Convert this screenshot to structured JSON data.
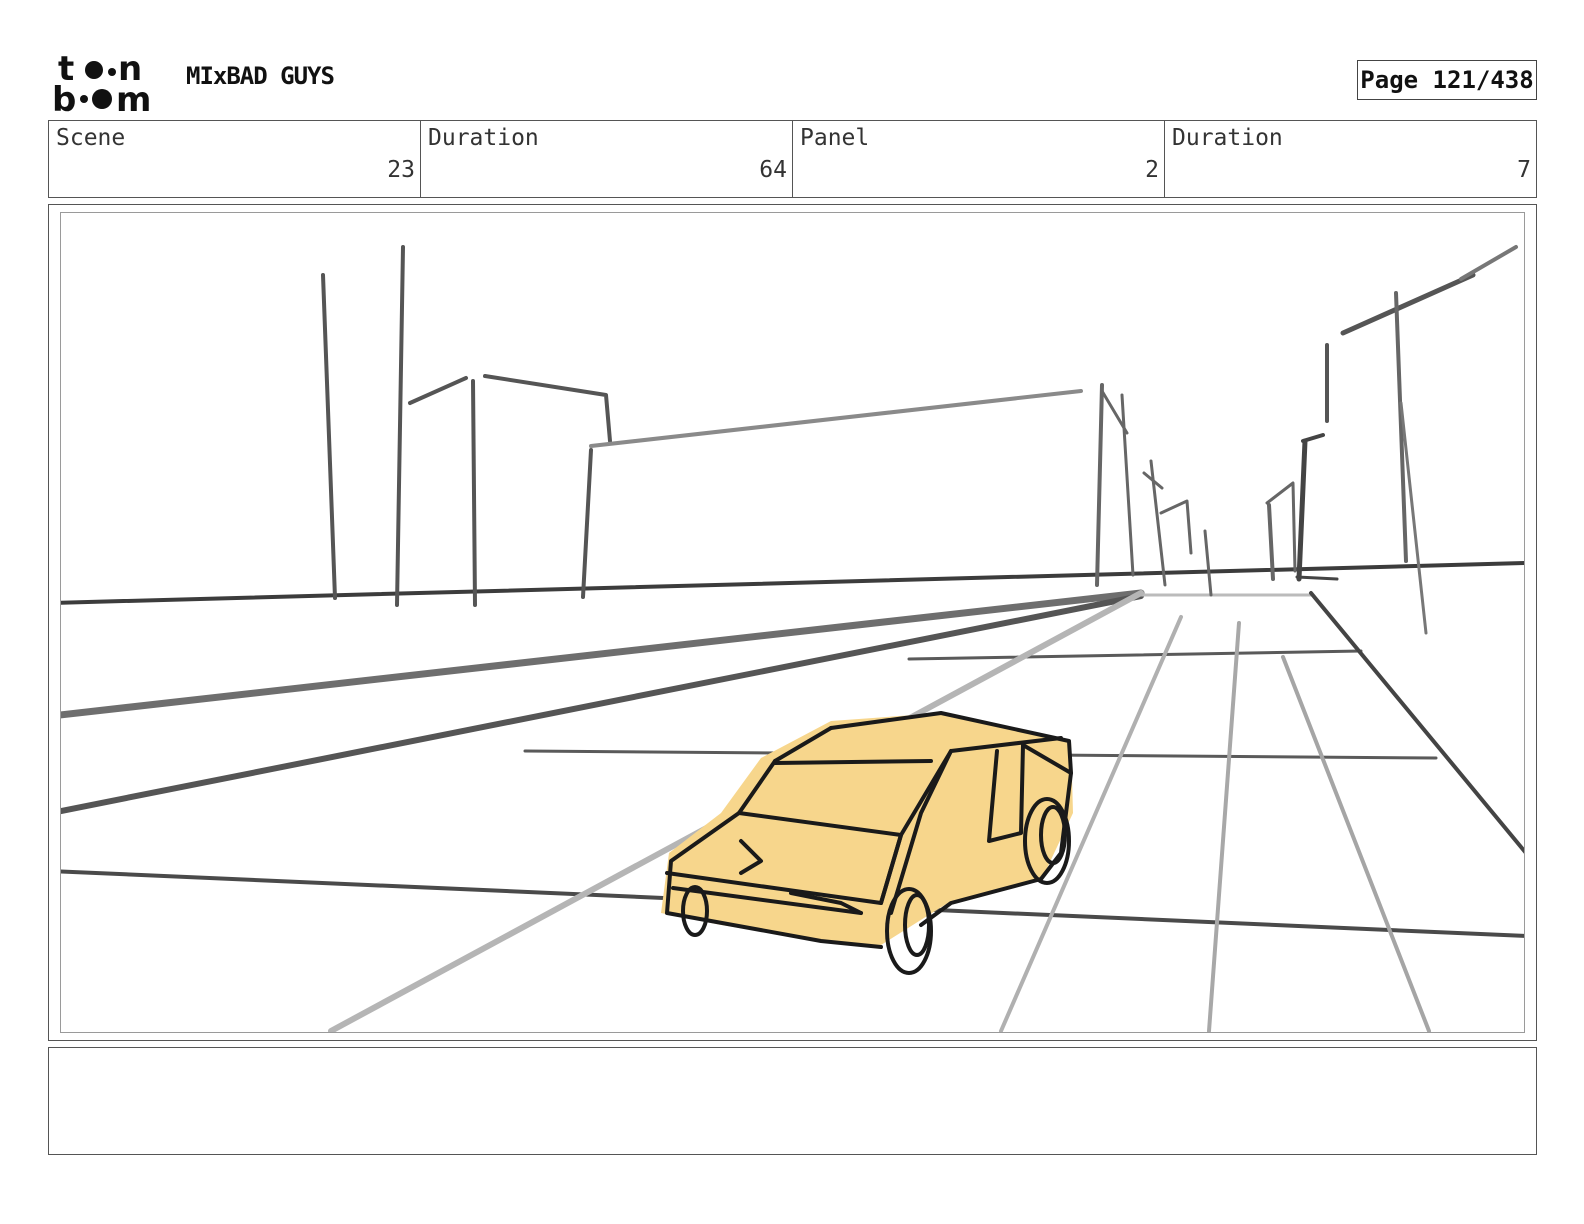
{
  "header": {
    "logo_text": "toon boom",
    "project_title": "MIxBAD GUYS",
    "page_label": "Page 121/438"
  },
  "info": [
    {
      "label": "Scene",
      "value": "23"
    },
    {
      "label": "Duration",
      "value": "64"
    },
    {
      "label": "Panel",
      "value": "2"
    },
    {
      "label": "Duration",
      "value": "7"
    }
  ],
  "panel": {
    "sketch_fill": "#f7d68c",
    "line_color": "#444444"
  },
  "notes": {
    "text": ""
  }
}
